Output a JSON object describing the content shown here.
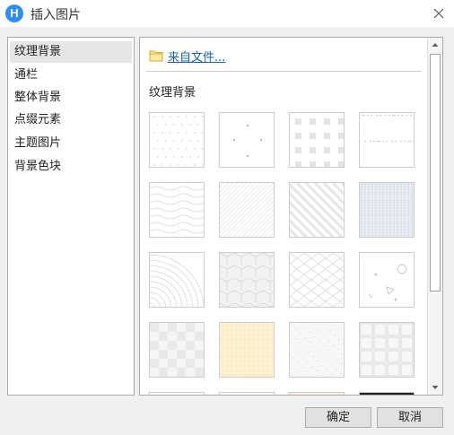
{
  "window": {
    "title": "插入图片",
    "logo_letter": "H"
  },
  "sidebar": {
    "items": [
      {
        "label": "纹理背景",
        "selected": true
      },
      {
        "label": "通栏",
        "selected": false
      },
      {
        "label": "整体背景",
        "selected": false
      },
      {
        "label": "点缀元素",
        "selected": false
      },
      {
        "label": "主题图片",
        "selected": false
      },
      {
        "label": "背景色块",
        "selected": false
      }
    ]
  },
  "main": {
    "from_file_label": "来自文件...",
    "section_title": "纹理背景",
    "thumbnails": [
      {
        "pattern": "dots-diagonal",
        "bg": "#ffffff"
      },
      {
        "pattern": "sparse-dots",
        "bg": "#ffffff"
      },
      {
        "pattern": "squares-grid",
        "bg": "#ffffff"
      },
      {
        "pattern": "speckles",
        "bg": "#ffffff"
      },
      {
        "pattern": "waves",
        "bg": "#ffffff"
      },
      {
        "pattern": "thin-diagonals",
        "bg": "#ffffff"
      },
      {
        "pattern": "bold-diagonals",
        "bg": "#ffffff"
      },
      {
        "pattern": "vertical-stripes",
        "bg": "#e9edf3"
      },
      {
        "pattern": "arcs",
        "bg": "#ffffff"
      },
      {
        "pattern": "cubes",
        "bg": "#f2f2f2"
      },
      {
        "pattern": "diamonds",
        "bg": "#ffffff"
      },
      {
        "pattern": "shapes",
        "bg": "#ffffff"
      },
      {
        "pattern": "checker",
        "bg": "#f5f5f5"
      },
      {
        "pattern": "fine-grid",
        "bg": "#fdf4d6"
      },
      {
        "pattern": "noise",
        "bg": "#f7f7f7"
      },
      {
        "pattern": "tiles",
        "bg": "#ececec"
      }
    ]
  },
  "footer": {
    "ok_label": "确定",
    "cancel_label": "取消"
  },
  "colors": {
    "link": "#1a5fb4",
    "selection": "#e6e6e6",
    "logo": "#2f8ff0"
  }
}
